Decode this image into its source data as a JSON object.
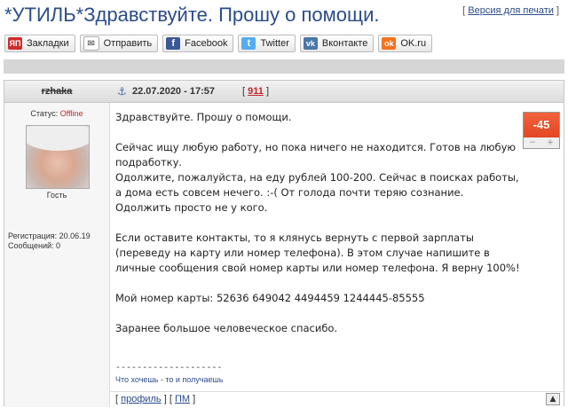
{
  "topic": {
    "title": "*УТИЛЬ*Здравствуйте. Прошу о помощи.",
    "print_link": "Версия для печати",
    "bracket_open": "[",
    "bracket_close": "]"
  },
  "share": [
    {
      "label": "Закладки",
      "icon_text": "ЯП",
      "icon": "bookmark-icon",
      "color": "#d12b2b"
    },
    {
      "label": "Отправить",
      "icon_text": "✉",
      "icon": "mail-icon",
      "color": "#ffffff"
    },
    {
      "label": "Facebook",
      "icon_text": "f",
      "icon": "facebook-icon",
      "color": "#3b5998"
    },
    {
      "label": "Twitter",
      "icon_text": "t",
      "icon": "twitter-icon",
      "color": "#55acee"
    },
    {
      "label": "Вконтакте",
      "icon_text": "vk",
      "icon": "vk-icon",
      "color": "#4a76a8"
    },
    {
      "label": "OK.ru",
      "icon_text": "ok",
      "icon": "ok-icon",
      "color": "#f4731c"
    }
  ],
  "post": {
    "author": "rzhaka",
    "date": "22.07.2020 - 17:57",
    "number": "911",
    "status_label": "Статус:",
    "status_value": "Offline",
    "role": "Гость",
    "registration": "Регистрация: 20.06.19",
    "messages": "Сообщений: 0",
    "rating": "-45",
    "rating_minus": "−",
    "rating_plus": "+",
    "body": [
      "Здравствуйте. Прошу о помощи.",
      "Сейчас ищу любую работу, но пока ничего не находится. Готов на любую подработку.\nОдолжите, пожалуйста, на еду рублей 100-200. Сейчас в поисках работы, а дома есть совсем нечего. :-( От голода почти теряю сознание. Одолжить просто не у кого.",
      "Если оставите контакты, то я клянусь вернуть с первой зарплаты (переведу на карту или номер телефона). В этом случае напишите в личные сообщения свой номер карты или номер телефона. Я верну 100%!",
      "Мой номер карты: 52636 649042 4494459 1244445-85555",
      "Заранее большое человеческое спасибо."
    ],
    "signature_line": "--------------------",
    "signature": "Что хочешь - то и получаешь",
    "profile_link": "профиль",
    "pm_link": "ПМ"
  }
}
